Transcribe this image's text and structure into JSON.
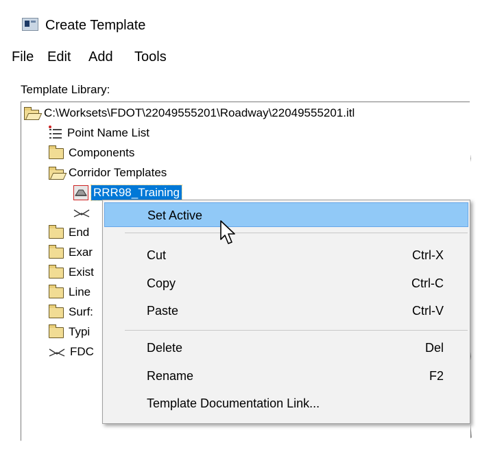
{
  "window": {
    "title": "Create Template"
  },
  "menubar": {
    "items": [
      "File",
      "Edit",
      "Add",
      "Tools"
    ]
  },
  "library": {
    "label": "Template Library:"
  },
  "tree": {
    "root": "C:\\Worksets\\FDOT\\22049555201\\Roadway\\22049555201.itl",
    "point_name_list": "Point Name List",
    "components": "Components",
    "corridor_templates": "Corridor Templates",
    "selected_template": "RRR98_Training",
    "partial_items": [
      "End",
      "Exar",
      "Exist",
      "Line",
      "Surf:",
      "Typi",
      "FDC"
    ]
  },
  "context_menu": {
    "items": [
      {
        "label": "Set Active",
        "shortcut": ""
      },
      {
        "label": "Cut",
        "shortcut": "Ctrl-X"
      },
      {
        "label": "Copy",
        "shortcut": "Ctrl-C"
      },
      {
        "label": "Paste",
        "shortcut": "Ctrl-V"
      },
      {
        "label": "Delete",
        "shortcut": "Del"
      },
      {
        "label": "Rename",
        "shortcut": "F2"
      },
      {
        "label": "Template Documentation Link...",
        "shortcut": ""
      }
    ],
    "hover_index": 0
  },
  "colors": {
    "selection": "#0078d7",
    "menu_hover": "#91c9f7",
    "menu_background": "#f2f2f2",
    "folder": "#f1dc94"
  }
}
